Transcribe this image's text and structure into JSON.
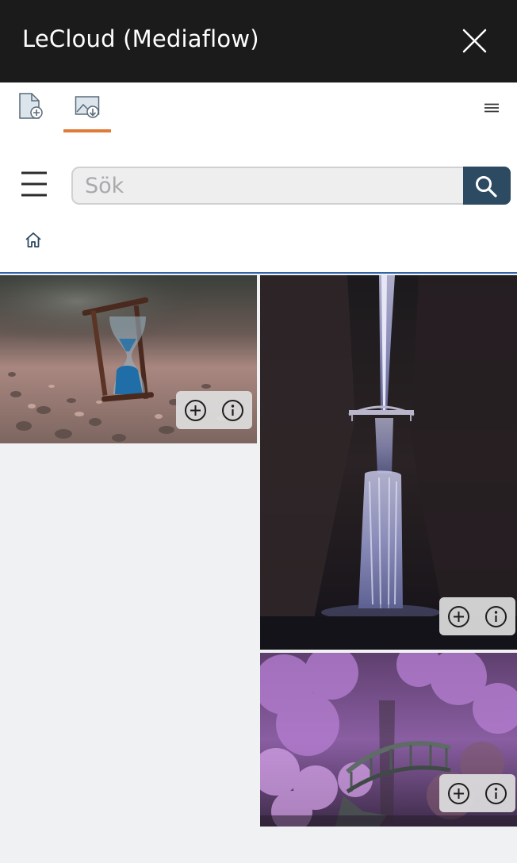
{
  "window": {
    "title": "LeCloud (Mediaflow)",
    "close_icon": "close-icon"
  },
  "toolbar": {
    "tabs": [
      {
        "icon": "document-add-icon",
        "selected": false
      },
      {
        "icon": "image-download-icon",
        "selected": true
      }
    ],
    "overflow_icon": "menu-lines-icon",
    "accent_color": "#e07b39"
  },
  "search": {
    "placeholder": "Sök",
    "value": "",
    "button_icon": "search-icon",
    "button_color": "#2c4a61"
  },
  "nav": {
    "menu_icon": "hamburger-icon",
    "home_icon": "home-icon"
  },
  "gallery": {
    "items": [
      {
        "subject": "hourglass",
        "actions": [
          "add-icon",
          "info-icon"
        ]
      },
      {
        "subject": "waterfall",
        "actions": [
          "add-icon",
          "info-icon"
        ]
      },
      {
        "subject": "purple garden bridge",
        "actions": [
          "add-icon",
          "info-icon"
        ]
      }
    ]
  }
}
